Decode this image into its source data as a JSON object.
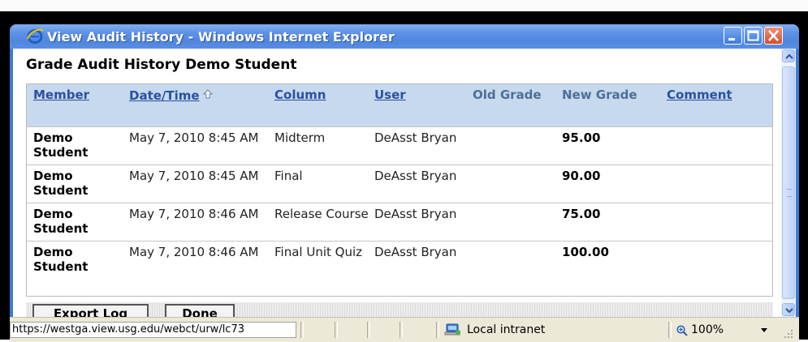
{
  "window": {
    "title": "View Audit History - Windows Internet Explorer"
  },
  "page": {
    "title": "Grade Audit History Demo Student"
  },
  "table": {
    "columns": [
      "Member",
      "Date/Time",
      "Column",
      "User",
      "Old Grade",
      "New Grade",
      "Comment"
    ],
    "rows": [
      {
        "member": "Demo Student",
        "datetime": "May 7, 2010 8:45 AM",
        "column": "Midterm",
        "user": "DeAsst Bryan",
        "old_grade": "",
        "new_grade": "95.00",
        "comment": ""
      },
      {
        "member": "Demo Student",
        "datetime": "May 7, 2010 8:45 AM",
        "column": "Final",
        "user": "DeAsst Bryan",
        "old_grade": "",
        "new_grade": "90.00",
        "comment": ""
      },
      {
        "member": "Demo Student",
        "datetime": "May 7, 2010 8:46 AM",
        "column": "Release Course",
        "user": "DeAsst Bryan",
        "old_grade": "",
        "new_grade": "75.00",
        "comment": ""
      },
      {
        "member": "Demo Student",
        "datetime": "May 7, 2010 8:46 AM",
        "column": "Final Unit Quiz",
        "user": "DeAsst Bryan",
        "old_grade": "",
        "new_grade": "100.00",
        "comment": ""
      }
    ]
  },
  "buttons": {
    "export_label": "Export Log",
    "done_label": "Done"
  },
  "statusbar": {
    "url": "https://westga.view.usg.edu/webct/urw/lc73",
    "zone": "Local intranet",
    "zoom": "100%"
  },
  "colors": {
    "titlebar": "#4f86de",
    "header_bg": "#c6d9ee",
    "link": "#2b50a0"
  }
}
